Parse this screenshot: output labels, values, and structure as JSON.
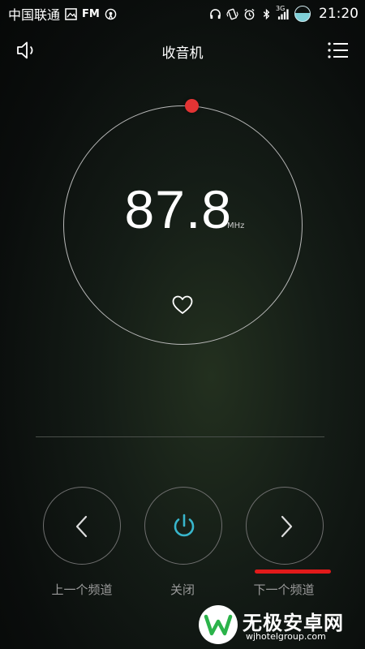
{
  "status_bar": {
    "carrier": "中国联通",
    "fm_label": "FM",
    "network_label": "3G",
    "time": "21:20",
    "icons": [
      "image-icon",
      "radio-broadcast-icon",
      "headphones-icon",
      "vibrate-icon",
      "alarm-icon",
      "bluetooth-icon",
      "signal-icon",
      "battery-icon"
    ]
  },
  "header": {
    "title": "收音机",
    "left_icon": "speaker-icon",
    "right_icon": "menu-icon"
  },
  "tuner": {
    "frequency": "87.8",
    "unit": "MHz",
    "favorite_icon": "heart-icon",
    "indicator_color": "#e23434"
  },
  "controls": {
    "prev_label": "上一个频道",
    "power_label": "关闭",
    "next_label": "下一个频道",
    "power_color": "#38b6cc",
    "highlight_color": "#e11a1a"
  },
  "watermark": {
    "name": "无极安卓网",
    "url": "wjhotelgroup.com"
  }
}
